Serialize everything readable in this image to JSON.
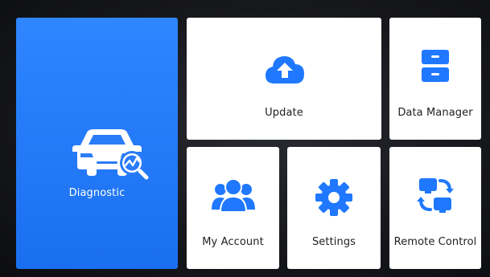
{
  "accent_color": "#1f78ff",
  "tiles": {
    "diagnostic": {
      "label": "Diagnostic",
      "icon": "car-diagnostic-icon"
    },
    "update": {
      "label": "Update",
      "icon": "cloud-upload-icon"
    },
    "data_manager": {
      "label": "Data Manager",
      "icon": "filing-cabinet-icon"
    },
    "my_account": {
      "label": "My Account",
      "icon": "users-icon"
    },
    "settings": {
      "label": "Settings",
      "icon": "gear-icon"
    },
    "remote_control": {
      "label": "Remote Control",
      "icon": "remote-screens-icon"
    }
  }
}
